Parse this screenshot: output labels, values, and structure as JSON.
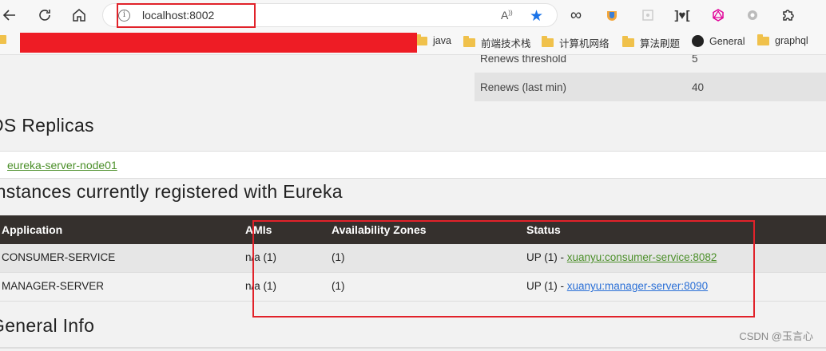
{
  "browser": {
    "url": "localhost:8002",
    "icons": [
      "back-icon",
      "reload-icon",
      "home-icon",
      "info-icon",
      "read-aloud-icon",
      "star-icon",
      "infinity-icon",
      "extension-icon",
      "extension-icon",
      "json-icon",
      "graphql-icon",
      "extension-icon",
      "puzzle-icon"
    ]
  },
  "bookmarks": [
    {
      "label": "java",
      "type": "folder"
    },
    {
      "label": "前端技术栈",
      "type": "folder"
    },
    {
      "label": "计算机网络",
      "type": "folder"
    },
    {
      "label": "算法刷题",
      "type": "folder"
    },
    {
      "label": "General",
      "type": "github"
    },
    {
      "label": "graphql",
      "type": "folder"
    }
  ],
  "stats": [
    {
      "key": "Renews threshold",
      "value": "5"
    },
    {
      "key": "Renews (last min)",
      "value": "40"
    }
  ],
  "replicas": {
    "title": "DS Replicas",
    "items": [
      "eureka-server-node01"
    ]
  },
  "instances": {
    "title": "Instances currently registered with Eureka",
    "headers": [
      "Application",
      "AMIs",
      "Availability Zones",
      "Status"
    ],
    "rows": [
      {
        "app": "CONSUMER-SERVICE",
        "ami": "n/a (1)",
        "zones": "(1)",
        "status_prefix": "UP (1) - ",
        "status_link": "xuanyu:consumer-service:8082"
      },
      {
        "app": "MANAGER-SERVER",
        "ami": "n/a (1)",
        "zones": "(1)",
        "status_prefix": "UP (1) - ",
        "status_link": "xuanyu:manager-server:8090"
      }
    ]
  },
  "general": {
    "title": "General Info"
  },
  "watermark": "CSDN @玉言心",
  "colors": {
    "highlight": "#e1222a",
    "header_bg": "#35302d",
    "link_green": "#4b8f29",
    "link_blue": "#2a6fd6"
  }
}
